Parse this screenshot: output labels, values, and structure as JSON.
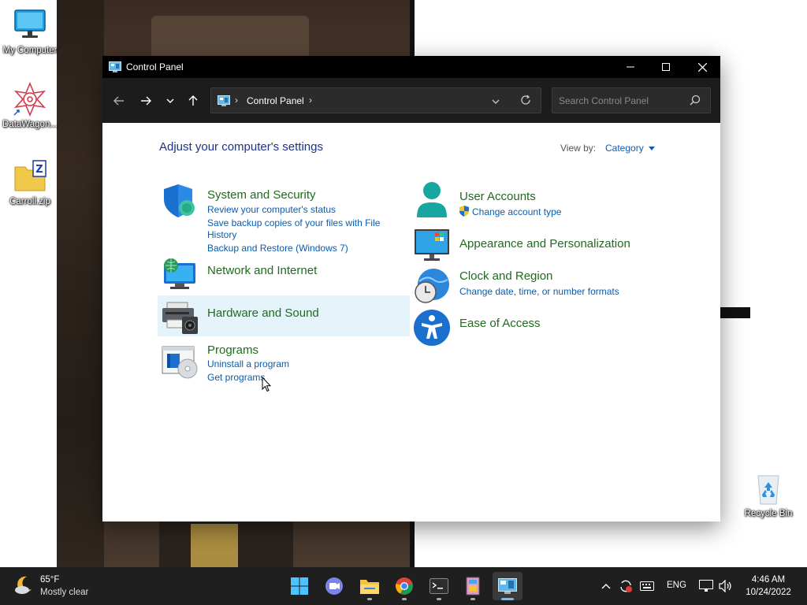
{
  "desktop": {
    "icons": [
      {
        "label": "My Computer"
      },
      {
        "label": "DataWagon..."
      },
      {
        "label": "Carroll.zip"
      },
      {
        "label": "Recycle Bin"
      }
    ]
  },
  "window": {
    "title": "Control Panel",
    "breadcrumb": "Control Panel",
    "search_placeholder": "Search Control Panel",
    "heading": "Adjust your computer's settings",
    "view_by_label": "View by:",
    "view_by_value": "Category",
    "categories": [
      {
        "title": "System and Security",
        "links": [
          "Review your computer's status",
          "Save backup copies of your files with File",
          "History",
          "Backup and Restore (Windows 7)"
        ]
      },
      {
        "title": "Network and Internet",
        "links": []
      },
      {
        "title": "Hardware and Sound",
        "links": []
      },
      {
        "title": "Programs",
        "links": [
          "Uninstall a program",
          "Get programs"
        ]
      },
      {
        "title": "User Accounts",
        "links": [
          "Change account type"
        ]
      },
      {
        "title": "Appearance and Personalization",
        "links": []
      },
      {
        "title": "Clock and Region",
        "links": [
          "Change date, time, or number formats"
        ]
      },
      {
        "title": "Ease of Access",
        "links": []
      }
    ]
  },
  "taskbar": {
    "weather_temp": "65°F",
    "weather_condition": "Mostly clear",
    "language": "ENG",
    "time": "4:46 AM",
    "date": "10/24/2022"
  },
  "colors": {
    "category_title": "#1f6b1f",
    "link": "#0b5cad",
    "heading": "#1e3287",
    "taskbar": "#1f1f1f"
  }
}
